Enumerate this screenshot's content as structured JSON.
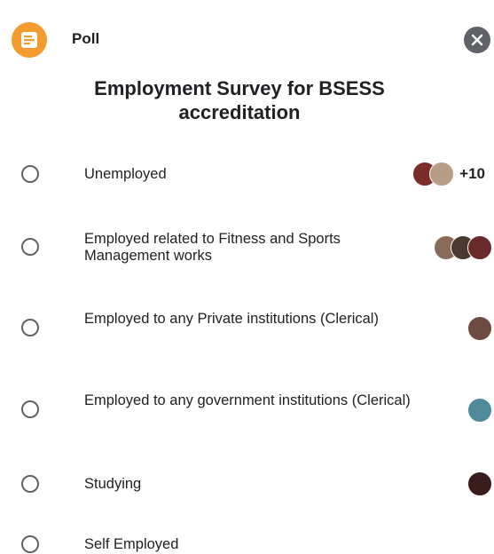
{
  "header": {
    "badge_icon": "poll-list-icon",
    "label": "Poll",
    "close_icon": "close-icon"
  },
  "poll": {
    "title": "Employment Survey for BSESS accreditation",
    "options": [
      {
        "text": "Unemployed",
        "avatars": [
          "#7a2c28",
          "#b79d86"
        ],
        "extra_votes": "+10"
      },
      {
        "text": "Employed related to Fitness and Sports Management works",
        "avatars": [
          "#8a6a58",
          "#4a3a30",
          "#6b2a2a"
        ],
        "extra_votes": ""
      },
      {
        "text": "Employed to any Private institutions (Clerical)",
        "avatars": [
          "#6e4b40"
        ],
        "extra_votes": ""
      },
      {
        "text": "Employed to any government institutions (Clerical)",
        "avatars": [
          "#4f8a9a"
        ],
        "extra_votes": ""
      },
      {
        "text": "Studying",
        "avatars": [
          "#3a1c1c"
        ],
        "extra_votes": ""
      },
      {
        "text": "Self Employed",
        "avatars": [],
        "extra_votes": ""
      }
    ]
  },
  "colors": {
    "badge": "#f39b2c",
    "close": "#5f6368",
    "radio_border": "#5f6368"
  }
}
